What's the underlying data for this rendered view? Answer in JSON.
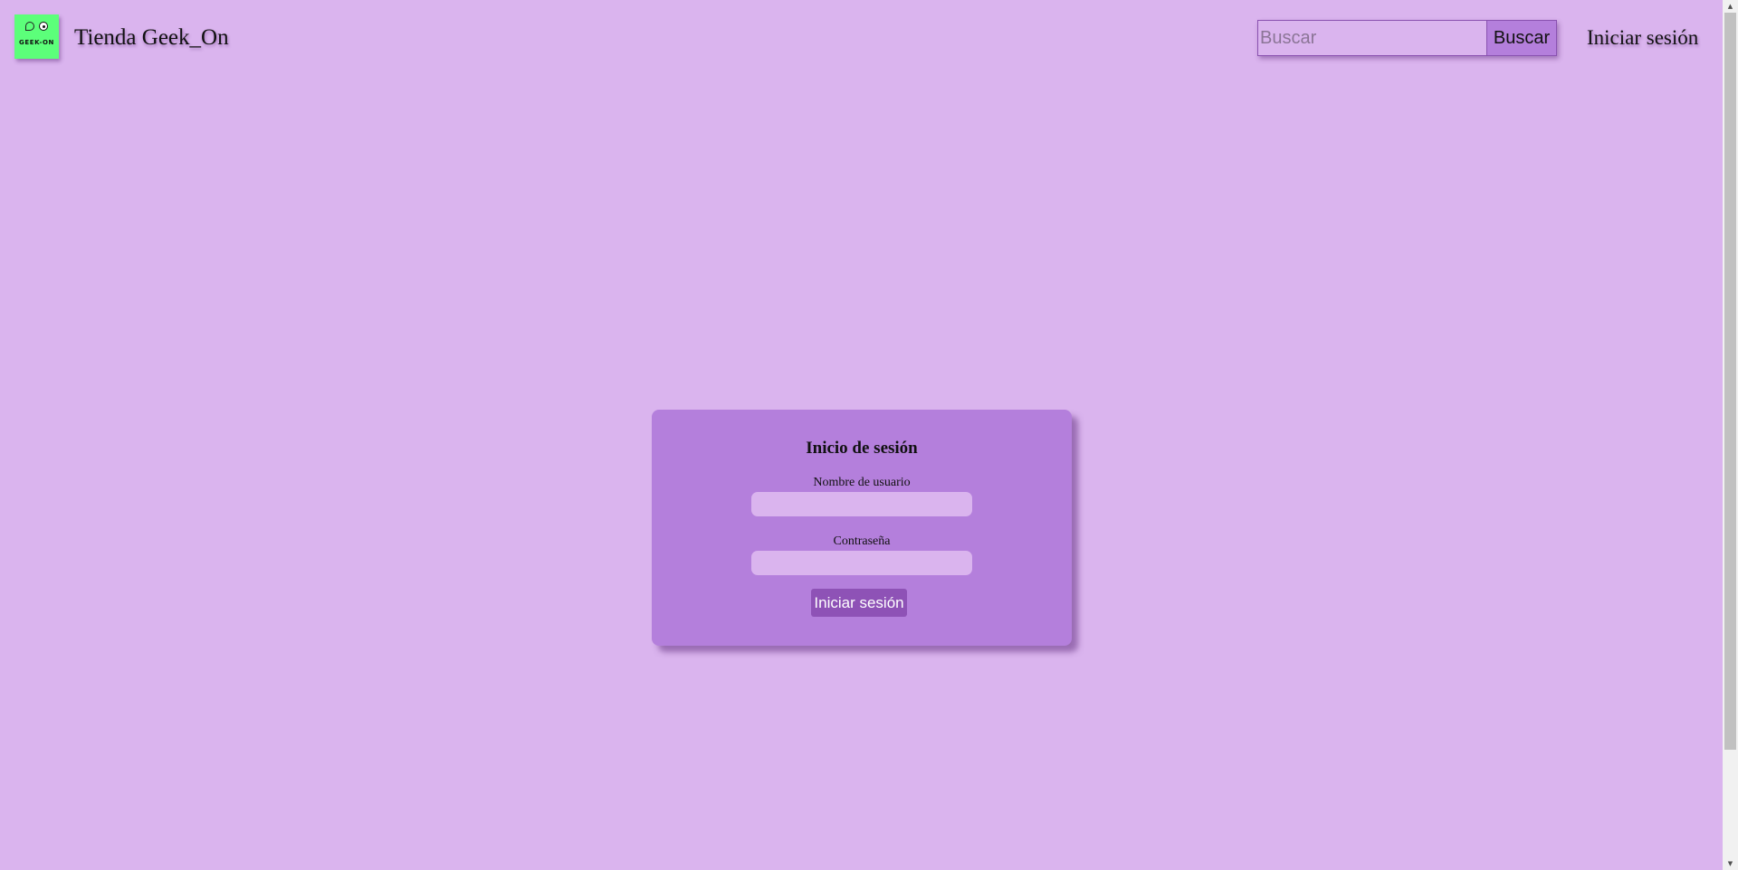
{
  "header": {
    "logo_text": "GEEK-ON",
    "site_title": "Tienda Geek_On",
    "search": {
      "placeholder": "Buscar",
      "value": "",
      "button_label": "Buscar"
    },
    "login_link": "Iniciar sesión"
  },
  "login_form": {
    "title": "Inicio de sesión",
    "username_label": "Nombre de usuario",
    "username_value": "",
    "password_label": "Contraseña",
    "password_value": "",
    "submit_label": "Iniciar sesión"
  },
  "scrollbar": {
    "up_icon": "▲",
    "down_icon": "▼"
  },
  "colors": {
    "background": "#dab4ee",
    "card": "#b47fdc",
    "button": "#8e52b6",
    "logo": "#5cff7a"
  }
}
